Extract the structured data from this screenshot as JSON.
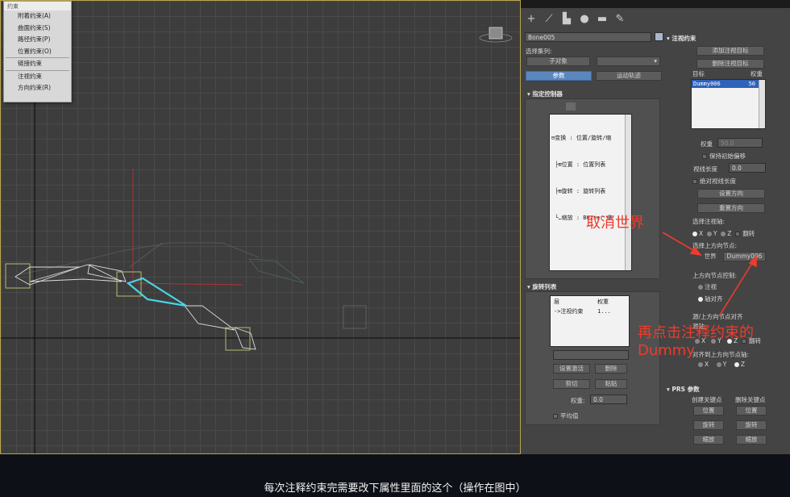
{
  "constraint_menu": {
    "title": "约束",
    "items": [
      "附着约束(A)",
      "曲面约束(S)",
      "路径约束(P)",
      "位置约束(O)",
      "链接约束",
      "注视约束",
      "方向约束(R)"
    ]
  },
  "toolbar": {
    "icons": [
      "plus-icon",
      "curve-icon",
      "hierarchy-icon",
      "motion-icon",
      "display-icon",
      "utility-icon"
    ],
    "glyphs": [
      "+",
      "⟋",
      "▙",
      "●",
      "▬",
      "✎"
    ]
  },
  "object": {
    "name": "Bone005",
    "color": "#a9b7cc"
  },
  "selection_set": {
    "label": "选择集列:",
    "sub_object": "子对象"
  },
  "tabs": {
    "params": "参数",
    "trajectories": "运动轨迹"
  },
  "assign_controller": {
    "title": "指定控制器",
    "tree": [
      "⊟变换 : 位置/旋转/缩",
      " ├⊞位置 : 位置列表",
      " ├⊞旋转 : 旋转列表",
      " └…缩放 : Bezier 缩"
    ]
  },
  "rotation_list": {
    "title": "旋转列表",
    "col_layer": "层",
    "col_weight": "权重",
    "row": {
      "layer": "->注视约束",
      "weight": "1..."
    },
    "buttons": {
      "set_active": "设置激活",
      "delete": "删除",
      "cut": "剪切",
      "paste": "粘贴"
    },
    "weight_label": "权重:",
    "weight_value": "0.0",
    "average": "平均值"
  },
  "lookat": {
    "title": "注视约束",
    "add_target": "添加注视目标",
    "delete_target": "删除注视目标",
    "col_target": "目标",
    "col_weight": "权重",
    "target_row": {
      "name": "Dummy006",
      "weight": "50"
    },
    "weight_label": "权重",
    "weight_value": "50.0",
    "keep_offset": "保持初始偏移",
    "viewline_length": "视线长度",
    "viewline_value": "0.0",
    "absolute_length": "绝对视线长度",
    "set_orientation": "设置方向",
    "reset_orientation": "重置方向",
    "select_axis": "选择注视轴:",
    "axes": [
      "X",
      "Y",
      "Z"
    ],
    "flip": "翻转",
    "select_upnode": "选择上方向节点:",
    "world": "世界",
    "upnode_value": "Dummy006",
    "upnode_control": "上方向节点控制:",
    "lookat_option": "注视",
    "axis_align": "轴对齐",
    "source_upnode_align": "源/上方向节点对齐",
    "source_axis": "源轴:",
    "aligned_to_upnode": "对齐到上方向节点轴:"
  },
  "prs": {
    "title": "PRS 参数",
    "create_key": "创建关键点",
    "delete_key": "删除关键点",
    "position": "位置",
    "rotation": "旋转",
    "scale": "缩放"
  },
  "annotations": {
    "cancel_world": "取消世界",
    "click_dummy_1": "再点击注释约束的",
    "click_dummy_2": "Dummy"
  },
  "caption": "每次注释约束完需要改下属性里面的这个（操作在图中）"
}
